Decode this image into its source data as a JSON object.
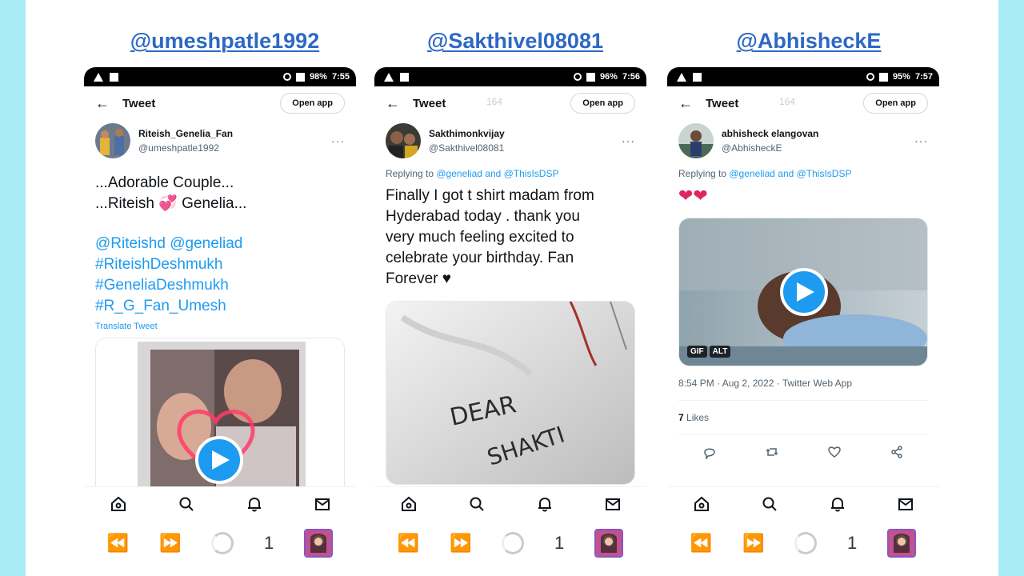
{
  "panels": [
    {
      "handle": "@umeshpatle1992",
      "status": {
        "battery": "98%",
        "time": "7:55"
      },
      "topbar": {
        "back": "←",
        "title": "Tweet",
        "open_app": "Open app"
      },
      "author": {
        "display_name": "Riteish_Genelia_Fan",
        "username": "@umeshpatle1992"
      },
      "text_lines": [
        "...Adorable Couple...",
        "...Riteish 💞 Genelia..."
      ],
      "link_lines": [
        "@Riteishd @geneliad",
        "#RiteishDeshmukh",
        "#GeneliaDeshmukh",
        "#R_G_Fan_Umesh"
      ],
      "translate": "Translate Tweet",
      "sys_count": "1"
    },
    {
      "handle": "@Sakthivel08081",
      "status": {
        "battery": "96%",
        "time": "7:56"
      },
      "topbar": {
        "back": "←",
        "title": "Tweet",
        "open_app": "Open app",
        "ghost": "164"
      },
      "author": {
        "display_name": "Sakthimonkvijay",
        "username": "@Sakthivel08081"
      },
      "replying": {
        "prefix": "Replying to ",
        "to": "@geneliad and @ThisIsDSP"
      },
      "text_lines": [
        "Finally I got t shirt madam from",
        "Hyderabad today . thank you",
        "very much feeling excited to",
        "celebrate your birthday. Fan",
        "Forever ♥"
      ],
      "shirt_text": [
        "DEAR",
        "SHAKTI"
      ],
      "sys_count": "1"
    },
    {
      "handle": "@AbhisheckE",
      "status": {
        "battery": "95%",
        "time": "7:57"
      },
      "topbar": {
        "back": "←",
        "title": "Tweet",
        "open_app": "Open app",
        "ghost": "164"
      },
      "author": {
        "display_name": "abhisheck elangovan",
        "username": "@AbhisheckE"
      },
      "replying": {
        "prefix": "Replying to ",
        "to": "@geneliad and @ThisIsDSP"
      },
      "text_lines": [
        "❤❤"
      ],
      "media_badges": [
        "GIF",
        "ALT"
      ],
      "timestamp": "8:54 PM · Aug 2, 2022 · Twitter Web App",
      "likes": {
        "count": "7",
        "label": "Likes"
      },
      "sys_count": "1"
    }
  ],
  "colors": {
    "accent": "#1d9bf0",
    "handle": "#2d68c4",
    "heart": "#e0245e",
    "frame": "#a9ecf8"
  }
}
